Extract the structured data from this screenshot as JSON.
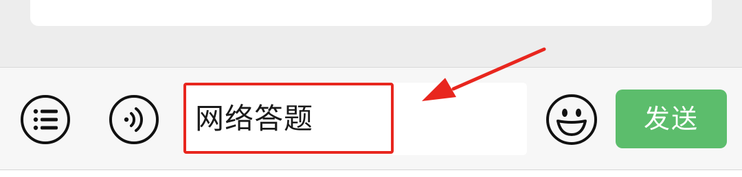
{
  "input": {
    "value": "网络答题"
  },
  "toolbar": {
    "send_label": "发送"
  },
  "icons": {
    "menu": "list-menu-icon",
    "voice": "voice-icon",
    "emoji": "smiley-face-icon",
    "annotation_arrow": "red-arrow-icon"
  },
  "colors": {
    "highlight": "#e8261e",
    "send_button": "#5cbd6c",
    "background": "#ededed",
    "toolbar": "#f7f7f7"
  }
}
